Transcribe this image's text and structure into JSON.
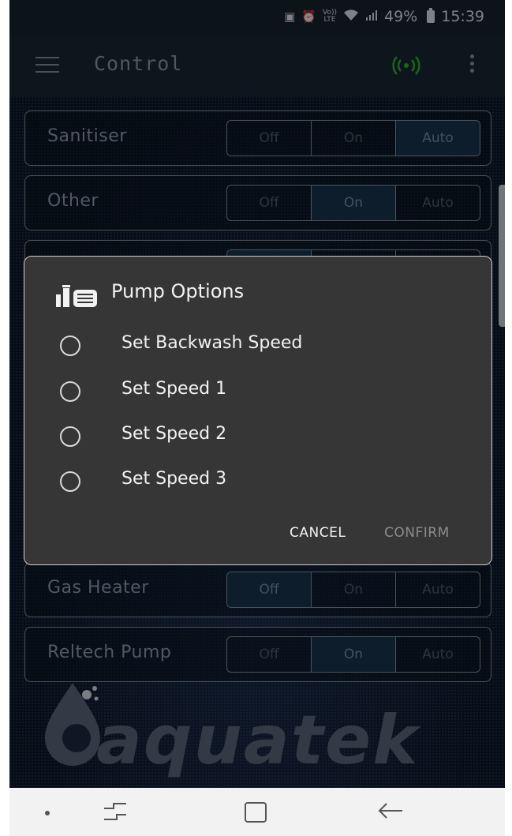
{
  "status_bar": {
    "lte_top": "Vo))",
    "lte_bottom": "LTE",
    "battery": "49%",
    "time": "15:39"
  },
  "app_bar": {
    "title": "Control",
    "signal_icon": "wifi-connected-icon",
    "menu_icon": "more-vert-icon",
    "signal_color": "#2fb82f"
  },
  "controls": [
    {
      "label": "Sanitiser",
      "options": [
        "Off",
        "On",
        "Auto"
      ],
      "selected": "Auto"
    },
    {
      "label": "Other",
      "options": [
        "Off",
        "On",
        "Auto"
      ],
      "selected": "On"
    },
    {
      "label": "Gas Heater",
      "options": [
        "Off",
        "On",
        "Auto"
      ],
      "selected": "Off"
    },
    {
      "label": "Reltech Pump",
      "options": [
        "Off",
        "On",
        "Auto"
      ],
      "selected": "On"
    }
  ],
  "dialog": {
    "title": "Pump Options",
    "icon": "pump-icon",
    "options": [
      "Set Backwash Speed",
      "Set Speed 1",
      "Set Speed 2",
      "Set Speed 3"
    ],
    "cancel_label": "CANCEL",
    "confirm_label": "CONFIRM"
  },
  "branding": {
    "logo_text": "aquatek"
  },
  "nav_bar": {
    "icons": [
      "dot-icon",
      "recents-icon",
      "home-icon",
      "back-icon"
    ]
  }
}
